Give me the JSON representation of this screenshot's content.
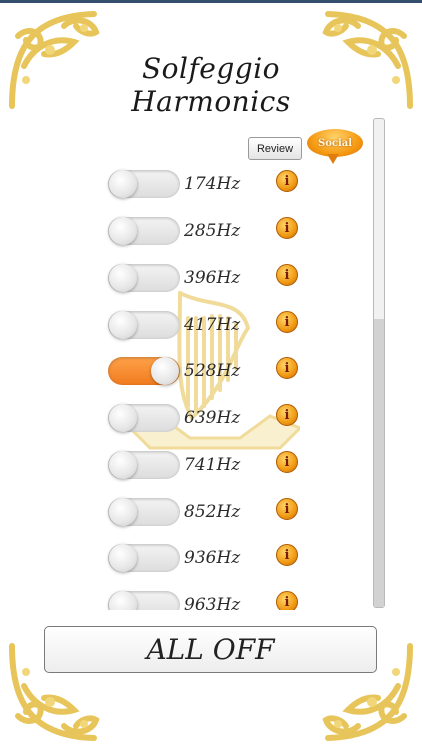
{
  "app": {
    "title": "Solfeggio Harmonics"
  },
  "actions": {
    "review_label": "Review",
    "social_label": "Social"
  },
  "frequencies": [
    {
      "label": "174Hz",
      "on": false
    },
    {
      "label": "285Hz",
      "on": false
    },
    {
      "label": "396Hz",
      "on": false
    },
    {
      "label": "417Hz",
      "on": false
    },
    {
      "label": "528Hz",
      "on": true
    },
    {
      "label": "639Hz",
      "on": false
    },
    {
      "label": "741Hz",
      "on": false
    },
    {
      "label": "852Hz",
      "on": false
    },
    {
      "label": "936Hz",
      "on": false
    },
    {
      "label": "963Hz",
      "on": false
    }
  ],
  "info_glyph": "i",
  "footer": {
    "all_off_label": "ALL OFF"
  },
  "colors": {
    "accent_orange": "#f07b1e",
    "ornament_gold": "#e8c55a"
  },
  "icons": {
    "info": "info-icon",
    "ornament": "corner-ornament",
    "harp": "harp-watermark"
  }
}
